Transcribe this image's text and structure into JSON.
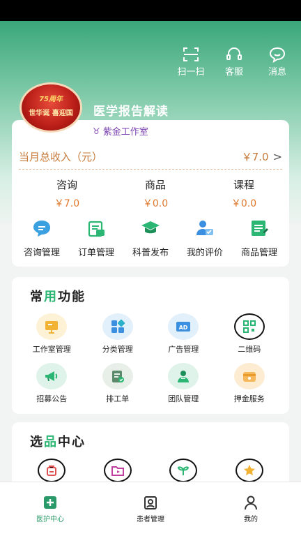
{
  "header": {
    "actions": [
      {
        "label": "扫一扫",
        "icon": "scan-icon"
      },
      {
        "label": "客服",
        "icon": "headset-icon"
      },
      {
        "label": "消息",
        "icon": "message-icon"
      }
    ],
    "avatar": {
      "top_text": "75周年",
      "bottom_text": "世华诞 喜迎国"
    },
    "store_name": "医学报告解读"
  },
  "summary": {
    "studio_label": "紫金工作室",
    "income_label": "当月总收入（元）",
    "income_value": "￥7.0",
    "stats": [
      {
        "label": "咨询",
        "value": "￥7.0"
      },
      {
        "label": "商品",
        "value": "￥0.0"
      },
      {
        "label": "课程",
        "value": "￥0.0"
      }
    ],
    "quick_actions": [
      {
        "label": "咨询管理",
        "icon": "consult-icon"
      },
      {
        "label": "订单管理",
        "icon": "order-icon"
      },
      {
        "label": "科普发布",
        "icon": "graduation-cap-icon"
      },
      {
        "label": "我的评价",
        "icon": "review-icon"
      },
      {
        "label": "商品管理",
        "icon": "goods-icon"
      }
    ]
  },
  "common_functions": {
    "title_pre": "常",
    "title_hl": "用",
    "title_post": "功能",
    "items": [
      {
        "label": "工作室管理",
        "icon": "studio-icon"
      },
      {
        "label": "分类管理",
        "icon": "category-icon"
      },
      {
        "label": "广告管理",
        "icon": "ad-icon"
      },
      {
        "label": "二维码",
        "icon": "qr-code-icon"
      },
      {
        "label": "招募公告",
        "icon": "megaphone-icon"
      },
      {
        "label": "排工单",
        "icon": "work-order-icon"
      },
      {
        "label": "团队管理",
        "icon": "team-icon"
      },
      {
        "label": "押金服务",
        "icon": "deposit-icon"
      }
    ]
  },
  "selection_center": {
    "title_pre": "选",
    "title_hl": "品",
    "title_post": "中心",
    "icons": [
      "bag-icon",
      "video-folder-icon",
      "plant-icon",
      "star-icon"
    ]
  },
  "tabbar": [
    {
      "label": "医护中心",
      "icon": "medical-plus-icon",
      "active": true
    },
    {
      "label": "患者管理",
      "icon": "patient-card-icon",
      "active": false
    },
    {
      "label": "我的",
      "icon": "user-icon",
      "active": false
    }
  ],
  "colors": {
    "brand_green": "#2bb673",
    "income_orange": "#e0782c",
    "studio_purple": "#7a3fb0"
  }
}
